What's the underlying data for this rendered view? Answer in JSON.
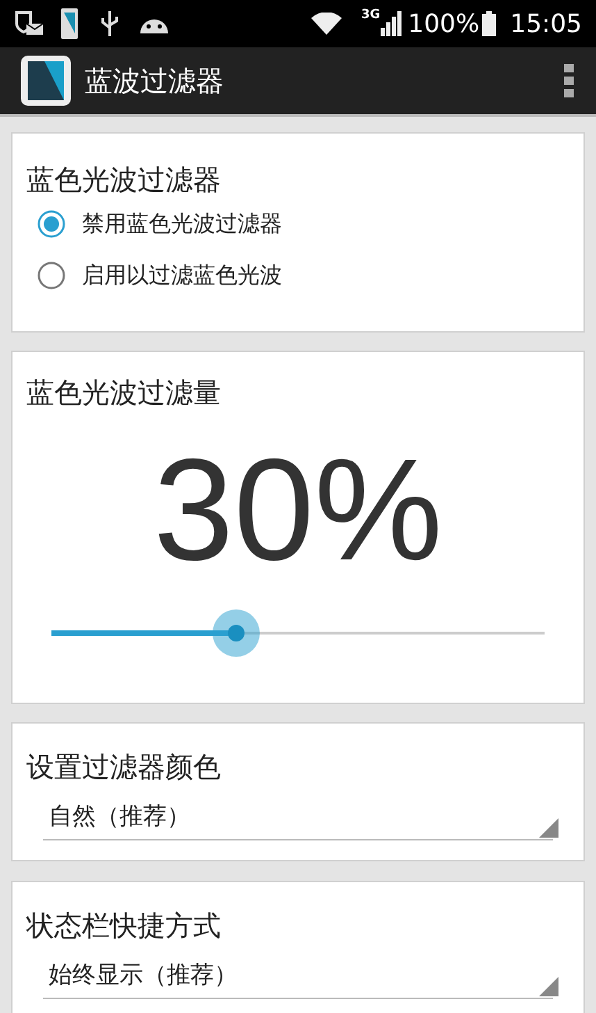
{
  "status_bar": {
    "network": "3G",
    "battery": "100%",
    "time": "15:05"
  },
  "app_bar": {
    "title": "蓝波过滤器"
  },
  "filter_toggle": {
    "title": "蓝色光波过滤器",
    "options": [
      {
        "label": "禁用蓝色光波过滤器",
        "selected": true
      },
      {
        "label": "启用以过滤蓝色光波",
        "selected": false
      }
    ]
  },
  "filter_amount": {
    "title": "蓝色光波过滤量",
    "reading": "30%",
    "level": 0.375
  },
  "dropdowns": [
    {
      "title": "设置过滤器颜色",
      "value": "自然（推荐）"
    },
    {
      "title": "状态栏快捷方式",
      "value": "始终显示（推荐）"
    }
  ]
}
